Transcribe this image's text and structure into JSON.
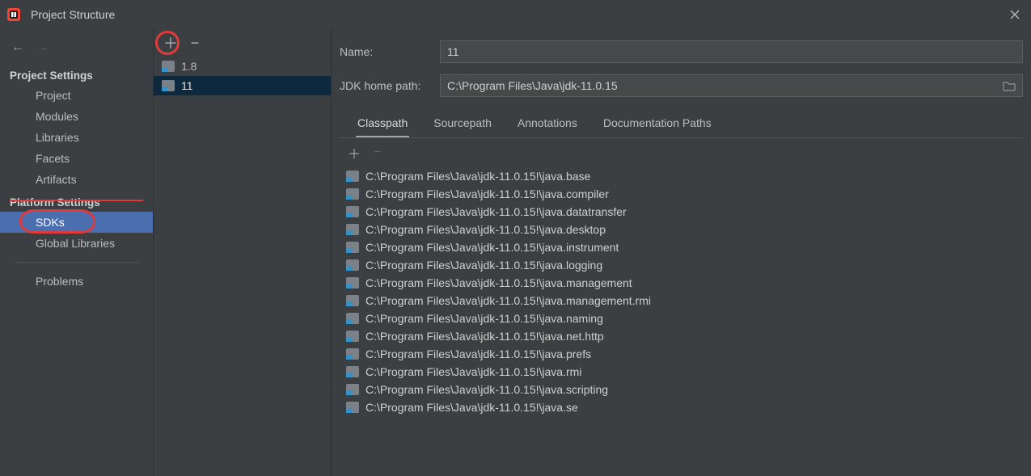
{
  "window": {
    "title": "Project Structure"
  },
  "nav": {
    "section_project": "Project Settings",
    "section_platform": "Platform Settings",
    "items_project": [
      "Project",
      "Modules",
      "Libraries",
      "Facets",
      "Artifacts"
    ],
    "items_platform": [
      "SDKs",
      "Global Libraries"
    ],
    "problems": "Problems",
    "selected": "SDKs"
  },
  "sdk_list": {
    "items": [
      "1.8",
      "11"
    ],
    "selected": "11"
  },
  "form": {
    "name_label": "Name:",
    "name_value": "11",
    "home_label": "JDK home path:",
    "home_value": "C:\\Program Files\\Java\\jdk-11.0.15"
  },
  "tabs": {
    "items": [
      "Classpath",
      "Sourcepath",
      "Annotations",
      "Documentation Paths"
    ],
    "active": "Classpath"
  },
  "classpath": [
    "C:\\Program Files\\Java\\jdk-11.0.15!\\java.base",
    "C:\\Program Files\\Java\\jdk-11.0.15!\\java.compiler",
    "C:\\Program Files\\Java\\jdk-11.0.15!\\java.datatransfer",
    "C:\\Program Files\\Java\\jdk-11.0.15!\\java.desktop",
    "C:\\Program Files\\Java\\jdk-11.0.15!\\java.instrument",
    "C:\\Program Files\\Java\\jdk-11.0.15!\\java.logging",
    "C:\\Program Files\\Java\\jdk-11.0.15!\\java.management",
    "C:\\Program Files\\Java\\jdk-11.0.15!\\java.management.rmi",
    "C:\\Program Files\\Java\\jdk-11.0.15!\\java.naming",
    "C:\\Program Files\\Java\\jdk-11.0.15!\\java.net.http",
    "C:\\Program Files\\Java\\jdk-11.0.15!\\java.prefs",
    "C:\\Program Files\\Java\\jdk-11.0.15!\\java.rmi",
    "C:\\Program Files\\Java\\jdk-11.0.15!\\java.scripting",
    "C:\\Program Files\\Java\\jdk-11.0.15!\\java.se"
  ]
}
